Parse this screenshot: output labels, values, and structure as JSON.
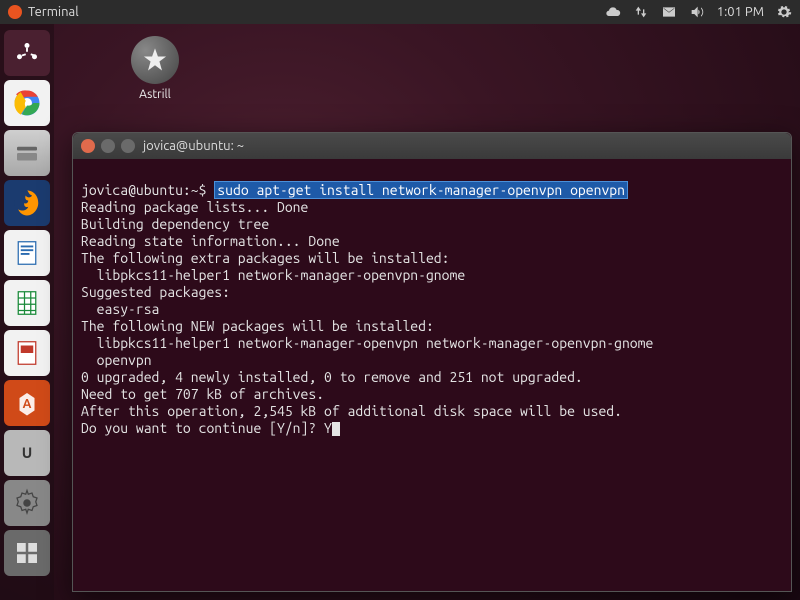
{
  "topbar": {
    "app_title": "Terminal",
    "time": "1:01 PM"
  },
  "desktop": {
    "astrill_label": "Astrill"
  },
  "terminal": {
    "title": "jovica@ubuntu: ~",
    "prompt_user": "jovica@ubuntu",
    "prompt_path": "~",
    "prompt_sep": ":",
    "prompt_end": "$",
    "command": "sudo apt-get install network-manager-openvpn openvpn",
    "lines": [
      "Reading package lists... Done",
      "Building dependency tree",
      "Reading state information... Done",
      "The following extra packages will be installed:",
      "  libpkcs11-helper1 network-manager-openvpn-gnome",
      "Suggested packages:",
      "  easy-rsa",
      "The following NEW packages will be installed:",
      "  libpkcs11-helper1 network-manager-openvpn network-manager-openvpn-gnome",
      "  openvpn",
      "0 upgraded, 4 newly installed, 0 to remove and 251 not upgraded.",
      "Need to get 707 kB of archives.",
      "After this operation, 2,545 kB of additional disk space will be used."
    ],
    "confirm_prompt": "Do you want to continue [Y/n]? ",
    "confirm_input": "Y"
  }
}
